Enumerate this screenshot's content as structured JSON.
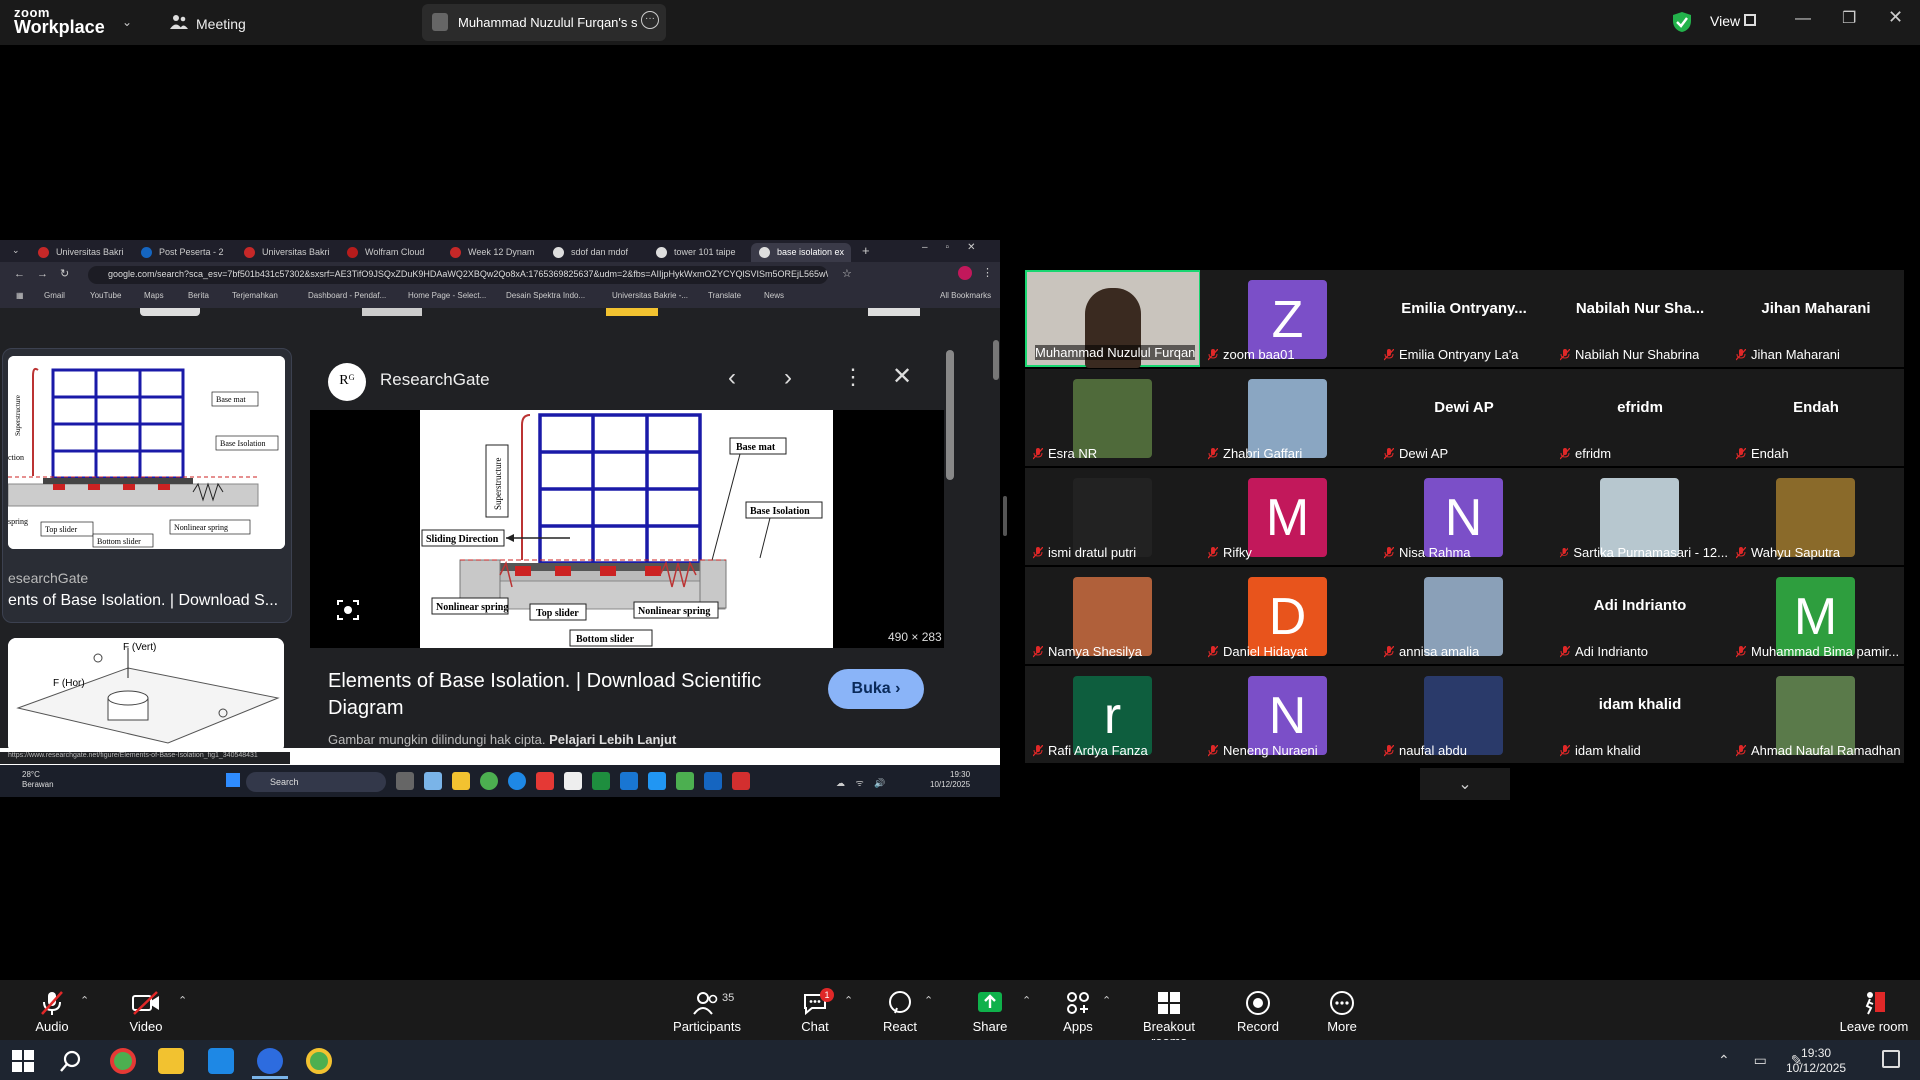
{
  "app": {
    "logo_top": "zoom",
    "logo_bottom": "Workplace",
    "meeting_label": "Meeting",
    "share_tab_label": "Muhammad Nuzulul Furqan's scr",
    "view_label": "View"
  },
  "browser": {
    "tabs": [
      "Universitas Bakri",
      "Post Peserta - 2",
      "Universitas Bakri",
      "Wolfram Cloud",
      "Week 12 Dynam",
      "sdof dan mdof",
      "tower 101 taipe",
      "base isolation ex"
    ],
    "address": "google.com/search?sca_esv=7bf501b431c57302&sxsrf=AE3TifO9JSQxZDuK9HDAaWQ2XBQw2Qo8xA:1765369825637&udm=2&fbs=AIIjpHykWxmOZYCYQlSVISm5OREjL565wWkEi...",
    "bookmarks": [
      "Gmail",
      "YouTube",
      "Maps",
      "Berita",
      "Terjemahkan",
      "Dashboard - Pendaf...",
      "Home Page - Select...",
      "Desain Spektra Indo...",
      "Universitas Bakrie -...",
      "Translate",
      "News",
      "All Bookmarks"
    ],
    "left_card_source": "esearchGate",
    "left_card_title": "ents of Base Isolation. | Download S...",
    "panel_source": "ResearchGate",
    "panel_logo": "Rᴳ",
    "image_dims": "490 × 283",
    "image_title": "Elements of Base Isolation. | Download Scientific Diagram",
    "image_sub": "Gambar mungkin dilindungi hak cipta.",
    "image_sub_link": "Pelajari Lebih Lanjut",
    "open_button": "Buka",
    "status_url": "https://www.researchgate.net/figure/Elements-of-Base-Isolation_fig1_340548431",
    "weather_temp": "28°C",
    "weather_desc": "Berawan",
    "taskbar_search": "Search",
    "clock_time": "19:30",
    "clock_date": "10/12/2025",
    "diagram_labels": {
      "base_mat": "Base mat",
      "superstructure": "Superstructure",
      "base_isolation": "Base Isolation",
      "sliding_direction": "Sliding Direction",
      "nonlinear_spring_left": "Nonlinear spring",
      "top_slider": "Top slider",
      "nonlinear_spring_right": "Nonlinear spring",
      "bottom_slider": "Bottom slider",
      "small_base_mat": "Base mat",
      "small_superstructure": "Superstructure",
      "small_base_isolation": "Base Isolation",
      "small_top_slider": "Top slider",
      "small_nonlinear": "Nonlinear spring",
      "small_bottom": "Bottom slider",
      "small_spring": "spring",
      "small_ction": "ction",
      "fvert": "F (Vert)",
      "fhor": "F (Hor)"
    }
  },
  "gallery": {
    "tiles": [
      {
        "name": "Muhammad Nuzulul Furqan",
        "kind": "video",
        "bg": "#c9c4bd",
        "active": true
      },
      {
        "name": "zoom baa01",
        "kind": "letter",
        "letter": "Z",
        "bg": "#7b4fc8"
      },
      {
        "name": "Emilia Ontryany La'a",
        "kind": "text",
        "big": "Emilia  Ontryany..."
      },
      {
        "name": "Nabilah Nur Shabrina",
        "kind": "text",
        "big": "Nabilah Nur Sha..."
      },
      {
        "name": "Jihan Maharani",
        "kind": "text",
        "big": "Jihan Maharani"
      },
      {
        "name": "Esra NR",
        "kind": "photo",
        "bg": "#4f6a3a"
      },
      {
        "name": "Zhabri Gaffari",
        "kind": "photo",
        "bg": "#8aa6c2"
      },
      {
        "name": "Dewi AP",
        "kind": "text",
        "big": "Dewi AP"
      },
      {
        "name": "efridm",
        "kind": "text",
        "big": "efridm"
      },
      {
        "name": "Endah",
        "kind": "text",
        "big": "Endah"
      },
      {
        "name": "ismi dratul putri",
        "kind": "blank",
        "bg": "#222"
      },
      {
        "name": "Rifky",
        "kind": "letter",
        "letter": "M",
        "bg": "#c2185b"
      },
      {
        "name": "Nisa Rahma",
        "kind": "letter",
        "letter": "N",
        "bg": "#7b4fc8"
      },
      {
        "name": "Sartika Purnamasari - 12...",
        "kind": "photo",
        "bg": "#b7c7cf"
      },
      {
        "name": "Wahyu Saputra",
        "kind": "photo",
        "bg": "#8a6a2a"
      },
      {
        "name": "Namya Shesilya",
        "kind": "photo",
        "bg": "#b0603a"
      },
      {
        "name": "Daniel Hidayat",
        "kind": "letter",
        "letter": "D",
        "bg": "#e8541c"
      },
      {
        "name": "annisa amalia",
        "kind": "photo",
        "bg": "#8aa0b8"
      },
      {
        "name": "Adi Indrianto",
        "kind": "text",
        "big": "Adi Indrianto"
      },
      {
        "name": "Muhammad Bima pamir...",
        "kind": "letter",
        "letter": "M",
        "bg": "#2e9e3e"
      },
      {
        "name": "Rafi Ardya Fanza",
        "kind": "letter",
        "letter": "r",
        "bg": "#0e5e3e"
      },
      {
        "name": "Neneng Nuraeni",
        "kind": "letter",
        "letter": "N",
        "bg": "#7b4fc8"
      },
      {
        "name": "naufal abdu",
        "kind": "photo",
        "bg": "#2a3a6a"
      },
      {
        "name": "idam khalid",
        "kind": "text",
        "big": "idam khalid"
      },
      {
        "name": "Ahmad Naufal Ramadhan",
        "kind": "photo",
        "bg": "#5a7a4a"
      }
    ]
  },
  "toolbar": {
    "audio": "Audio",
    "video": "Video",
    "participants": "Participants",
    "participants_count": "35",
    "chat": "Chat",
    "chat_badge": "1",
    "react": "React",
    "share": "Share",
    "apps": "Apps",
    "breakout": "Breakout rooms",
    "record": "Record",
    "more": "More",
    "leave": "Leave room"
  },
  "taskbar": {
    "time": "19:30",
    "date": "10/12/2025"
  },
  "colors": {
    "accent_green": "#19d671",
    "share_green": "#0fb14b",
    "muted_red": "#e02828"
  }
}
